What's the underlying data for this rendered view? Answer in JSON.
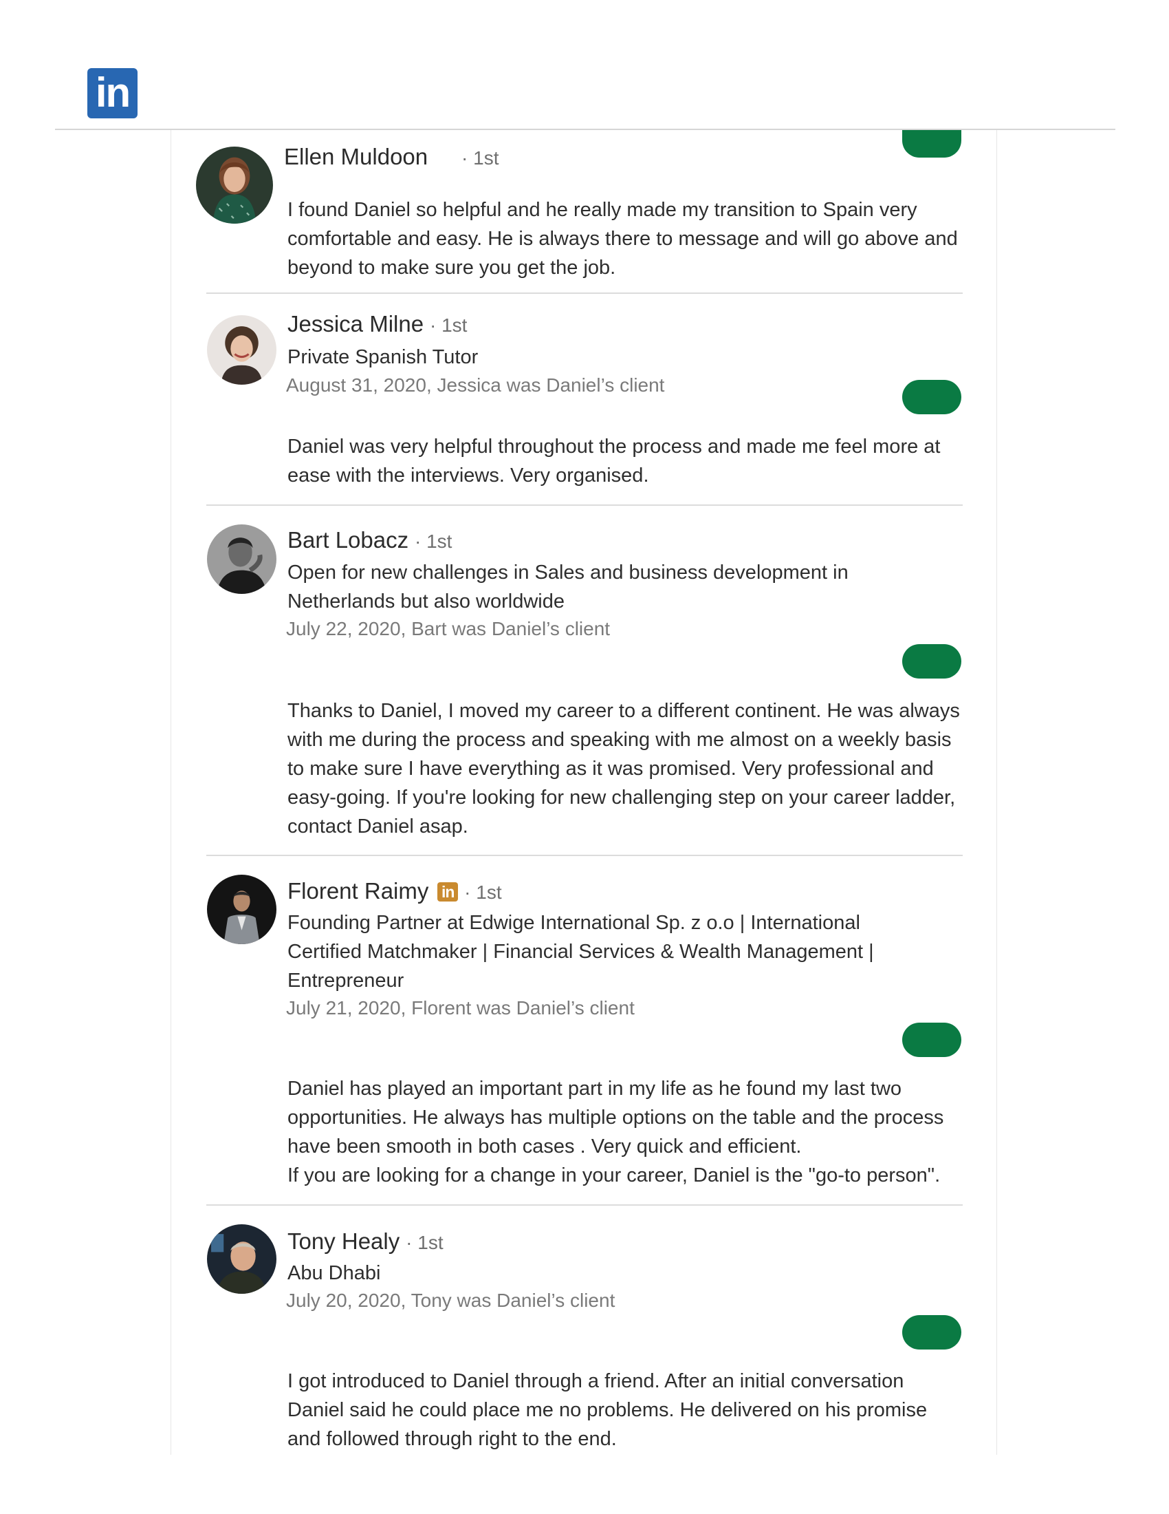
{
  "brand": {
    "logo_text": "in"
  },
  "recommendations": [
    {
      "name": "Ellen Muldoon",
      "degree": "· 1st",
      "body": [
        "I found Daniel so helpful and he really made my transition to Spain very comfortable and easy. He is always there to message and will go above and beyond to make sure you get the job."
      ]
    },
    {
      "name": "Jessica Milne",
      "degree": "· 1st",
      "headline": "Private Spanish Tutor",
      "meta": "August 31, 2020, Jessica was Daniel’s client",
      "body": [
        "Daniel was very helpful throughout the process and made me feel more at ease with the interviews. Very organised."
      ]
    },
    {
      "name": "Bart Lobacz",
      "degree": "· 1st",
      "headline": "Open for new challenges in Sales and business development in Netherlands but also worldwide",
      "meta": "July 22, 2020, Bart was Daniel’s client",
      "body": [
        "Thanks to Daniel, I moved my career to a different continent. He was always with me during the process and speaking with me almost on a weekly basis to make sure I have everything as it was promised. Very professional and easy-going. If you're looking for new challenging step on your career ladder, contact Daniel asap."
      ]
    },
    {
      "name": "Florent Raimy",
      "badge": "in",
      "degree": "· 1st",
      "headline": "Founding Partner at Edwige International Sp. z o.o | International Certified Matchmaker | Financial Services & Wealth Management | Entrepreneur",
      "meta": "July 21, 2020, Florent was Daniel’s client",
      "body": [
        "Daniel has played an important part in my life as he found my last two opportunities. He always has multiple options on the table and the process have been smooth in both cases . Very quick and efficient.",
        "If you are looking for a change in your career, Daniel is the \"go-to person\"."
      ]
    },
    {
      "name": "Tony Healy",
      "degree": "· 1st",
      "headline": "Abu Dhabi",
      "meta": "July 20, 2020, Tony was Daniel’s client",
      "body": [
        "I got introduced to Daniel through a friend. After an initial conversation Daniel said he could place me no problems. He delivered on his promise and followed through right to the end."
      ]
    }
  ],
  "colors": {
    "linkedin_blue": "#2867b2",
    "action_green": "#0a7a43",
    "premium_gold": "#c98a2f"
  }
}
